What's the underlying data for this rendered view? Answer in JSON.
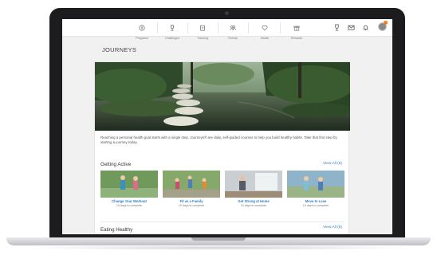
{
  "nav": {
    "items": [
      {
        "label": "Programs",
        "icon": "compass-icon"
      },
      {
        "label": "Challenges",
        "icon": "trophy-icon"
      },
      {
        "label": "Tracking",
        "icon": "clipboard-icon"
      },
      {
        "label": "Friends",
        "icon": "people-icon"
      },
      {
        "label": "Health",
        "icon": "heart-icon"
      },
      {
        "label": "Rewards",
        "icon": "gift-icon"
      }
    ],
    "utilities": [
      "trophy-icon",
      "mail-icon",
      "bell-icon"
    ],
    "accent_color": "#f07f1a"
  },
  "page": {
    "title": "JOURNEYS",
    "intro": "Reaching a personal health goal starts with a single step. Journeys® are daily, self-guided courses to help you build healthy habits. Take that first step by starting a journey today."
  },
  "sections": [
    {
      "title": "Getting Active",
      "view_all": "View All (5)",
      "tiles": [
        {
          "name": "Change Your Workout",
          "days": "10 days to complete"
        },
        {
          "name": "Fit as a Family",
          "days": "10 days to complete"
        },
        {
          "name": "Get Strong at Home",
          "days": "10 days to complete"
        },
        {
          "name": "Move to Lose",
          "days": "10 days to complete"
        }
      ]
    },
    {
      "title": "Eating Healthy",
      "view_all": "View All (5)"
    }
  ],
  "link_color": "#2d7fc2"
}
